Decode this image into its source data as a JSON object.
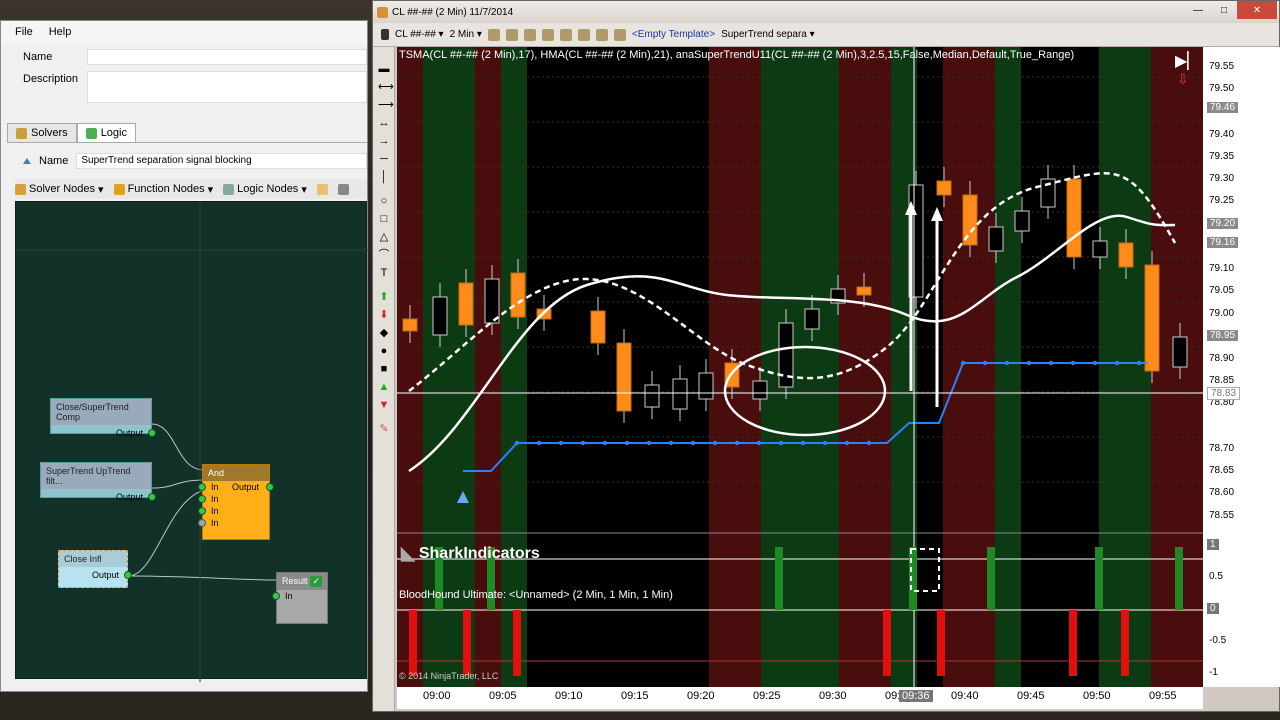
{
  "logic_window": {
    "menu": [
      "File",
      "Help"
    ],
    "name_label": "Name",
    "description_label": "Description",
    "tabs": [
      "Solvers",
      "Logic"
    ],
    "active_tab": "Logic",
    "logic_name_label": "Name",
    "logic_name_value": "SuperTrend separation signal blocking",
    "node_toolbar": [
      "Solver Nodes",
      "Function Nodes",
      "Logic Nodes"
    ],
    "nodes": {
      "close_st_comp": {
        "title": "Close/SuperTrend Comp",
        "output": "Output"
      },
      "st_uptrend": {
        "title": "SuperTrend UpTrend filt...",
        "output": "Output"
      },
      "close_infl": {
        "title": "Close Infl",
        "output": "Output"
      },
      "and_node": {
        "title": "And",
        "inputs": [
          "In",
          "In",
          "In",
          "In"
        ],
        "output": "Output"
      },
      "result_node": {
        "title": "Result",
        "input": "In"
      }
    }
  },
  "chart_window": {
    "title": "CL ##-## (2 Min)  11/7/2014",
    "toolbar": {
      "instrument": "CL ##-##",
      "interval": "2 Min",
      "template": "<Empty Template>",
      "strategy": "SuperTrend separa"
    },
    "indicator_label": "TSMA(CL ##-## (2 Min),17),  HMA(CL ##-## (2 Min),21),  anaSuperTrendU11(CL ##-## (2 Min),3,2.5,15,False,Median,Default,True_Range)",
    "lower_label": "BloodHound Ultimate: <Unnamed> (2 Min, 1 Min, 1 Min)",
    "watermark": "SharkIndicators",
    "copyright": "© 2014 NinjaTrader, LLC",
    "price_axis": [
      "79.55",
      "79.50",
      "79.40",
      "79.35",
      "79.30",
      "79.25",
      "79.10",
      "79.05",
      "79.00",
      "78.90",
      "78.85",
      "78.80",
      "78.70",
      "78.65",
      "78.60",
      "78.55"
    ],
    "price_tags": [
      "79.46",
      "79.20",
      "79.16",
      "78.95",
      "78.83"
    ],
    "lower_axis": [
      "1",
      "0.5",
      "0",
      "-0.5",
      "-1"
    ],
    "time_axis": [
      "09:00",
      "09:05",
      "09:10",
      "09:15",
      "09:20",
      "09:25",
      "09:30",
      "09:35",
      "09:40",
      "09:45",
      "09:50",
      "09:55"
    ],
    "cursor_time": "09:36",
    "colors": {
      "up": "#ff8c1a",
      "bull_band": "#0c3a12",
      "bear_band": "#4a0d0d",
      "supertrend": "#2f7fff"
    }
  }
}
